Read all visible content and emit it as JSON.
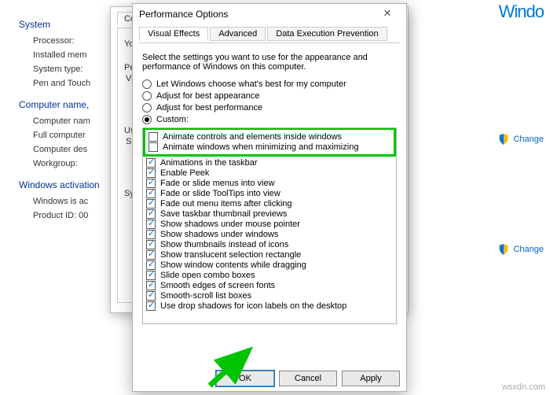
{
  "winlogo_text": "Windo",
  "bg": {
    "section1": "System",
    "r1": "Processor:",
    "r2": "Installed mem",
    "r3": "System type:",
    "r4": "Pen and Touch",
    "section2": "Computer name,",
    "r5": "Computer nam",
    "r6": "Full computer",
    "r7": "Computer des",
    "r8": "Workgroup:",
    "section3": "Windows activation",
    "r9": "Windows is ac",
    "r10": "Product ID: 00",
    "change1": "Change",
    "change2": "Change"
  },
  "sysprops": {
    "tab": "Compu",
    "intro": "You",
    "sec1": "Per",
    "sec1b": "Vis",
    "sec2": "Use",
    "sec2b": "Set",
    "sec3": "Sys",
    "settings": "S"
  },
  "perf": {
    "title": "Performance Options",
    "tabs": {
      "t1": "Visual Effects",
      "t2": "Advanced",
      "t3": "Data Execution Prevention"
    },
    "intro": "Select the settings you want to use for the appearance and performance of Windows on this computer.",
    "opt1": "Let Windows choose what's best for my computer",
    "opt2": "Adjust for best appearance",
    "opt3": "Adjust for best performance",
    "opt4": "Custom:",
    "items": [
      "Animate controls and elements inside windows",
      "Animate windows when minimizing and maximizing",
      "Animations in the taskbar",
      "Enable Peek",
      "Fade or slide menus into view",
      "Fade or slide ToolTips into view",
      "Fade out menu items after clicking",
      "Save taskbar thumbnail previews",
      "Show shadows under mouse pointer",
      "Show shadows under windows",
      "Show thumbnails instead of icons",
      "Show translucent selection rectangle",
      "Show window contents while dragging",
      "Slide open combo boxes",
      "Smooth edges of screen fonts",
      "Smooth-scroll list boxes",
      "Use drop shadows for icon labels on the desktop"
    ],
    "btn_ok": "OK",
    "btn_cancel": "Cancel",
    "btn_apply": "Apply"
  },
  "watermark": "wsxdn.com"
}
